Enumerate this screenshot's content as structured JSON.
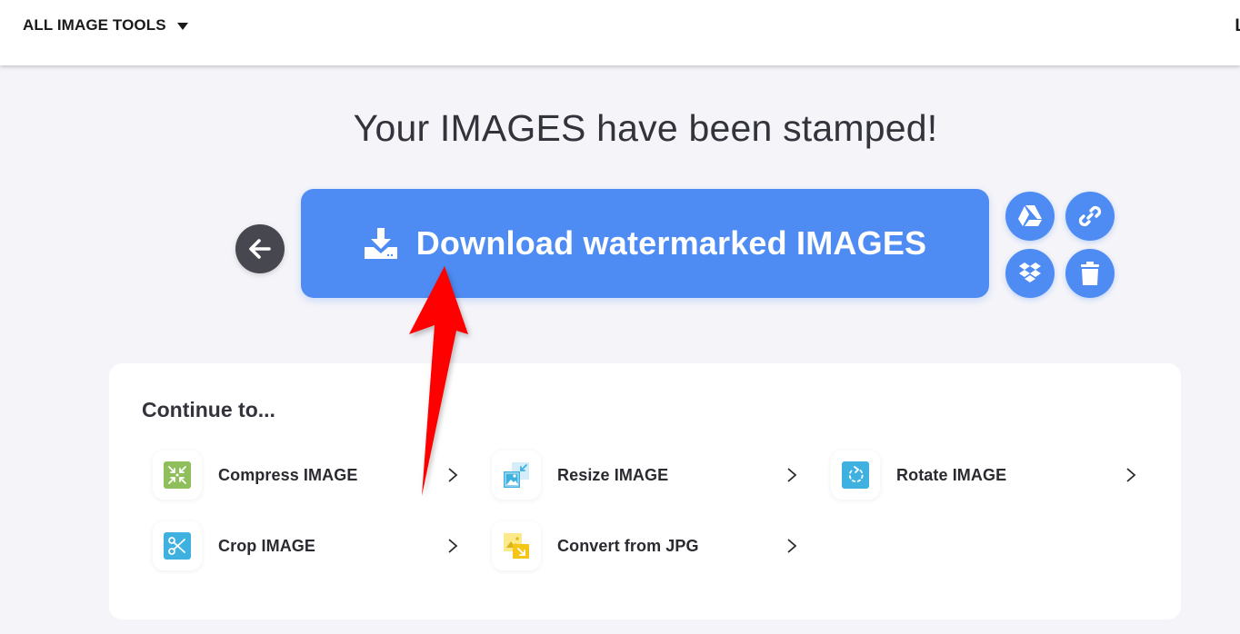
{
  "topbar": {
    "tools_menu_label": "ALL IMAGE TOOLS",
    "tools_menu_icon": "caret-down-icon",
    "right_partial_text": "L"
  },
  "headline": "Your IMAGES have been stamped!",
  "actions": {
    "back_icon": "arrow-left-icon",
    "download_label": "Download watermarked IMAGES",
    "download_icon": "download-icon",
    "side_buttons": [
      {
        "name": "google-drive",
        "icon": "google-drive-icon"
      },
      {
        "name": "copy-link",
        "icon": "link-icon"
      },
      {
        "name": "dropbox",
        "icon": "dropbox-icon"
      },
      {
        "name": "delete",
        "icon": "trash-icon"
      }
    ]
  },
  "continue": {
    "title": "Continue to...",
    "items": [
      {
        "label": "Compress IMAGE",
        "icon": "compress-icon",
        "color": "#8fbf5a"
      },
      {
        "label": "Resize IMAGE",
        "icon": "resize-icon",
        "color": "#3eb1e0"
      },
      {
        "label": "Rotate IMAGE",
        "icon": "rotate-icon",
        "color": "#3eb1e0"
      },
      {
        "label": "Crop IMAGE",
        "icon": "crop-icon",
        "color": "#3eb1e0"
      },
      {
        "label": "Convert from JPG",
        "icon": "convert-icon",
        "color": "#f5c518"
      }
    ]
  },
  "colors": {
    "accent": "#4e8cf4",
    "back_button": "#47474f",
    "annotation_arrow": "#ff0000",
    "background": "#f4f4f9"
  }
}
